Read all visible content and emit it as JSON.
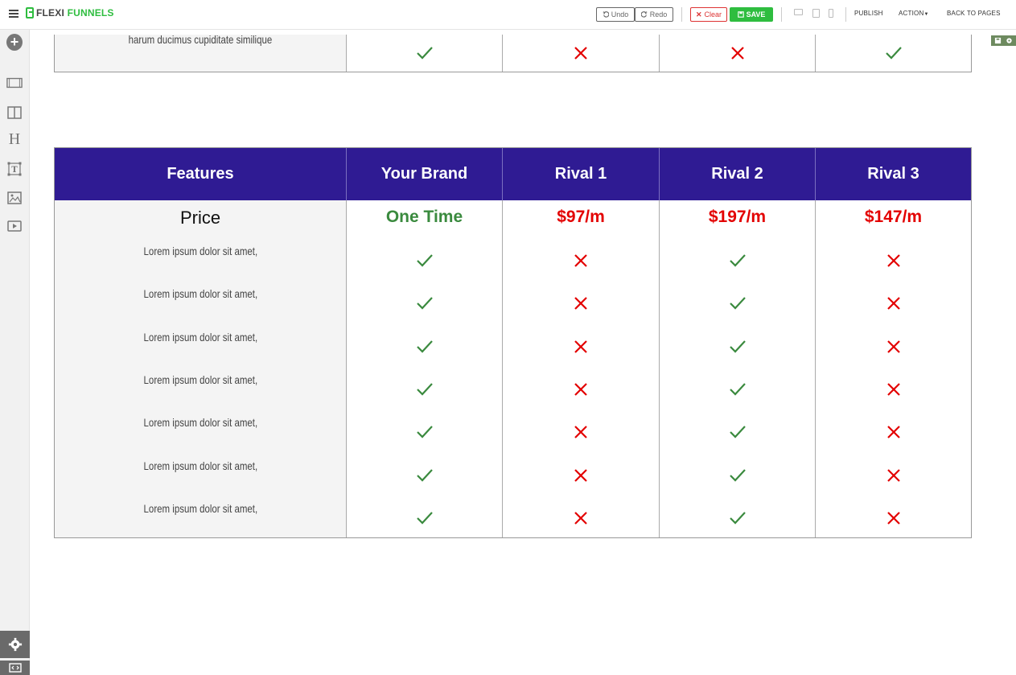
{
  "app": {
    "logo_left": "FLEXI",
    "logo_right": "FUNNELS"
  },
  "toolbar": {
    "undo_label": "Undo",
    "redo_label": "Redo",
    "clear_label": "Clear",
    "save_label": "SAVE",
    "publish_label": "PUBLISH",
    "action_label": "ACTION",
    "back_label": "BACK TO PAGES"
  },
  "colors": {
    "brand_green": "#2ebd3f",
    "header_bg": "#2f1b93",
    "check_green": "#3a8a3e",
    "cross_red": "#e30000"
  },
  "top_partial_row": {
    "feature": "harum ducimus cupiditate similique",
    "marks": [
      "check",
      "cross",
      "cross",
      "check"
    ]
  },
  "comparison": {
    "headers": [
      "Features",
      "Your Brand",
      "Rival 1",
      "Rival 2",
      "Rival 3"
    ],
    "price_label": "Price",
    "prices": [
      "One Time",
      "$97/m",
      "$197/m",
      "$147/m"
    ],
    "rows": [
      {
        "label": "Lorem ipsum dolor sit amet,",
        "marks": [
          "check",
          "cross",
          "check",
          "cross"
        ]
      },
      {
        "label": "Lorem ipsum dolor sit amet,",
        "marks": [
          "check",
          "cross",
          "check",
          "cross"
        ]
      },
      {
        "label": "Lorem ipsum dolor sit amet,",
        "marks": [
          "check",
          "cross",
          "check",
          "cross"
        ]
      },
      {
        "label": "Lorem ipsum dolor sit amet,",
        "marks": [
          "check",
          "cross",
          "check",
          "cross"
        ]
      },
      {
        "label": "Lorem ipsum dolor sit amet,",
        "marks": [
          "check",
          "cross",
          "check",
          "cross"
        ]
      },
      {
        "label": "Lorem ipsum dolor sit amet,",
        "marks": [
          "check",
          "cross",
          "check",
          "cross"
        ]
      },
      {
        "label": "Lorem ipsum dolor sit amet,",
        "marks": [
          "check",
          "cross",
          "check",
          "cross"
        ]
      }
    ]
  },
  "sidebar": {
    "icons": [
      "add-element-icon",
      "section-icon",
      "columns-icon",
      "heading-icon",
      "text-icon",
      "image-icon",
      "video-icon"
    ],
    "bottom_icons": [
      "settings-icon",
      "code-icon"
    ]
  }
}
